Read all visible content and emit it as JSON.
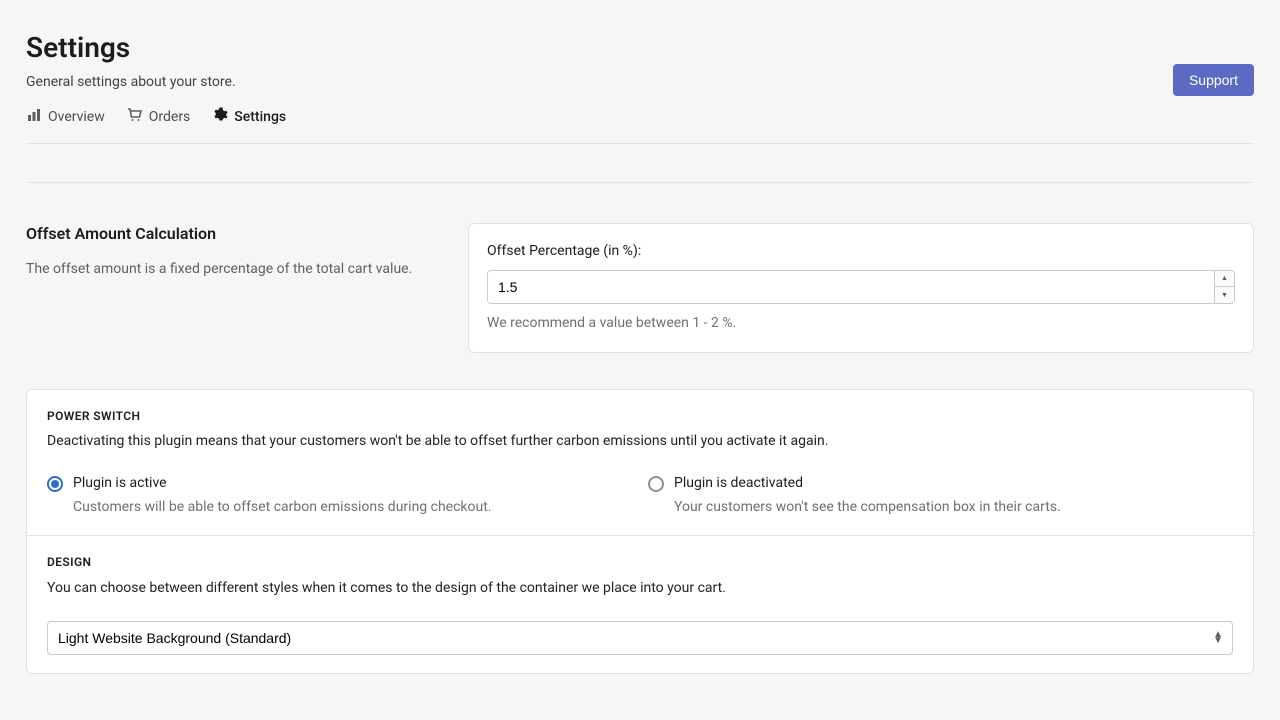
{
  "header": {
    "title": "Settings",
    "subtitle": "General settings about your store.",
    "support_label": "Support"
  },
  "tabs": {
    "overview": "Overview",
    "orders": "Orders",
    "settings": "Settings"
  },
  "offset_section": {
    "heading": "Offset Amount Calculation",
    "description": "The offset amount is a fixed percentage of the total cart value.",
    "field_label": "Offset Percentage (in %):",
    "value": "1.5",
    "hint": "We recommend a value between 1 - 2 %."
  },
  "power_switch": {
    "heading": "POWER SWITCH",
    "description": "Deactivating this plugin means that your customers won't be able to offset further carbon emissions until you activate it again.",
    "active": {
      "label": "Plugin is active",
      "sub": "Customers will be able to offset carbon emissions during checkout."
    },
    "deactivated": {
      "label": "Plugin is deactivated",
      "sub": "Your customers won't see the compensation box in their carts."
    }
  },
  "design": {
    "heading": "DESIGN",
    "description": "You can choose between different styles when it comes to the design of the container we place into your cart.",
    "selected": "Light Website Background (Standard)"
  }
}
